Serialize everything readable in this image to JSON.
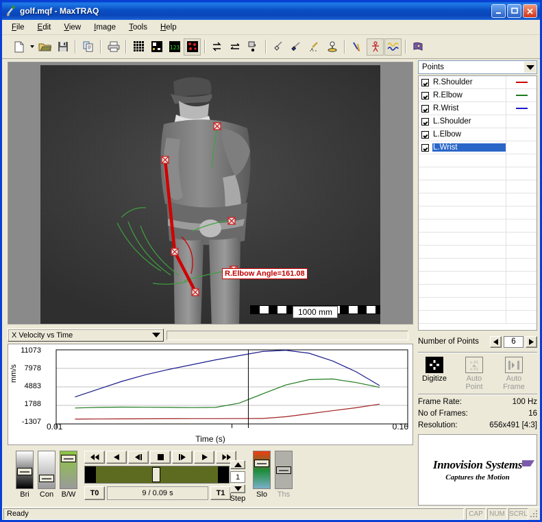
{
  "window": {
    "title": "golf.mqf - MaxTRAQ",
    "icon": "golf-club-icon",
    "buttons": {
      "minimize": "–",
      "maximize": "❐",
      "close": "✕"
    }
  },
  "menu": [
    {
      "label": "File",
      "accel": "F"
    },
    {
      "label": "Edit",
      "accel": "E"
    },
    {
      "label": "View",
      "accel": "V"
    },
    {
      "label": "Image",
      "accel": "I"
    },
    {
      "label": "Tools",
      "accel": "T"
    },
    {
      "label": "Help",
      "accel": "H"
    }
  ],
  "toolbar": [
    {
      "name": "new-file-icon"
    },
    {
      "name": "new-file-dropdown-icon"
    },
    {
      "name": "open-folder-icon"
    },
    {
      "name": "save-disk-icon"
    },
    {
      "name": "copy-icon"
    },
    {
      "name": "print-icon"
    },
    {
      "name": "grid-icon"
    },
    {
      "name": "calibration-icon"
    },
    {
      "name": "counter-icon"
    },
    {
      "name": "points-overlay-icon"
    },
    {
      "name": "swap-vertical-icon"
    },
    {
      "name": "swap-horizontal-icon"
    },
    {
      "name": "object-track-icon"
    },
    {
      "name": "measure-angle-icon"
    },
    {
      "name": "measure-distance-icon"
    },
    {
      "name": "pencil-path-icon"
    },
    {
      "name": "marker-icon"
    },
    {
      "name": "pen-tool-icon"
    },
    {
      "name": "stick-figure-icon"
    },
    {
      "name": "graph-wave-icon"
    },
    {
      "name": "book-help-icon"
    }
  ],
  "video": {
    "angle_annotation": "R.Elbow Angle=161.08",
    "scale_label": "1000 mm",
    "markers": [
      "R.Shoulder",
      "R.Elbow",
      "R.Wrist",
      "L.Shoulder",
      "L.Elbow",
      "L.Wrist"
    ],
    "colors": {
      "angle": "#c00000",
      "trace": "#3fa03f",
      "marker": "#cc2222"
    }
  },
  "chart_panel": {
    "plot_select": "X Velocity vs Time"
  },
  "chart_data": {
    "type": "line",
    "title": "X Velocity vs Time",
    "xlabel": "Time (s)",
    "ylabel": "mm/s",
    "xlim": [
      0.01,
      0.16
    ],
    "ylim": [
      -1307,
      11073
    ],
    "xticks": [
      "0.01",
      "0.16"
    ],
    "yticks": [
      11073,
      7978,
      4883,
      1788,
      -1307
    ],
    "grid": true,
    "legend": "none",
    "cursor_time": 0.092,
    "x": [
      0.018,
      0.028,
      0.038,
      0.048,
      0.058,
      0.068,
      0.078,
      0.088,
      0.098,
      0.108,
      0.118,
      0.128,
      0.138,
      0.148
    ],
    "series": [
      {
        "name": "R.Shoulder",
        "color": "#a02020",
        "values": [
          -500,
          -480,
          -460,
          -450,
          -440,
          -430,
          -420,
          -410,
          -400,
          -100,
          400,
          900,
          1400,
          2000
        ]
      },
      {
        "name": "R.Elbow",
        "color": "#1d7a1d",
        "values": [
          1350,
          1450,
          1500,
          1480,
          1450,
          1420,
          1450,
          2150,
          3700,
          5200,
          6100,
          6200,
          5600,
          4800
        ]
      },
      {
        "name": "R.Wrist",
        "color": "#1a1a8c",
        "values": [
          3200,
          4500,
          5800,
          6900,
          7800,
          8600,
          9400,
          10100,
          10800,
          11000,
          10500,
          9200,
          7400,
          5100
        ]
      }
    ]
  },
  "playback": {
    "sliders": [
      {
        "name": "brightness",
        "label": "Bri"
      },
      {
        "name": "contrast",
        "label": "Con"
      },
      {
        "name": "black-white",
        "label": "B/W"
      }
    ],
    "transport": [
      {
        "name": "rewind-to-start",
        "glyph": "◀◀"
      },
      {
        "name": "play-backward",
        "glyph": "◀"
      },
      {
        "name": "step-backward",
        "glyph": "◀|"
      },
      {
        "name": "stop",
        "glyph": "■"
      },
      {
        "name": "step-forward",
        "glyph": "|▶"
      },
      {
        "name": "play-forward",
        "glyph": "▶"
      },
      {
        "name": "fast-forward",
        "glyph": "▶▶"
      }
    ],
    "t0_label": "T0",
    "t1_label": "T1",
    "time_readout": "9 /  0.09 s",
    "step_label": "Step",
    "step_value": "1",
    "slo_label": "Slo",
    "ths_label": "Ths"
  },
  "points_panel": {
    "selector": "Points",
    "items": [
      {
        "label": "R.Shoulder",
        "checked": true,
        "color": "#cc0000"
      },
      {
        "label": "R.Elbow",
        "checked": true,
        "color": "#1d7a1d"
      },
      {
        "label": "R.Wrist",
        "checked": true,
        "color": "#1a1acc"
      },
      {
        "label": "L.Shoulder",
        "checked": true,
        "color": ""
      },
      {
        "label": "L.Elbow",
        "checked": true,
        "color": ""
      },
      {
        "label": "L.Wrist",
        "checked": true,
        "color": "",
        "selected": true
      }
    ],
    "number_of_points_label": "Number of Points",
    "number_of_points_value": "6",
    "actions": [
      {
        "name": "digitize",
        "label_line1": "Digitize",
        "label_line2": "",
        "enabled": true
      },
      {
        "name": "auto-point",
        "label_line1": "Auto",
        "label_line2": "Point",
        "enabled": false
      },
      {
        "name": "auto-frame",
        "label_line1": "Auto",
        "label_line2": "Frame",
        "enabled": false
      }
    ],
    "info": [
      {
        "key": "Frame Rate:",
        "value": "100  Hz"
      },
      {
        "key": "No of Frames:",
        "value": "16"
      },
      {
        "key": "Resolution:",
        "value": "656x491 [4:3]"
      }
    ]
  },
  "branding": {
    "name": "Innovision Systems",
    "tagline": "Captures the Motion",
    "accent": "#7a5ca8"
  },
  "statusbar": {
    "message": "Ready",
    "indicators": [
      "CAP",
      "NUM",
      "SCRL"
    ]
  }
}
